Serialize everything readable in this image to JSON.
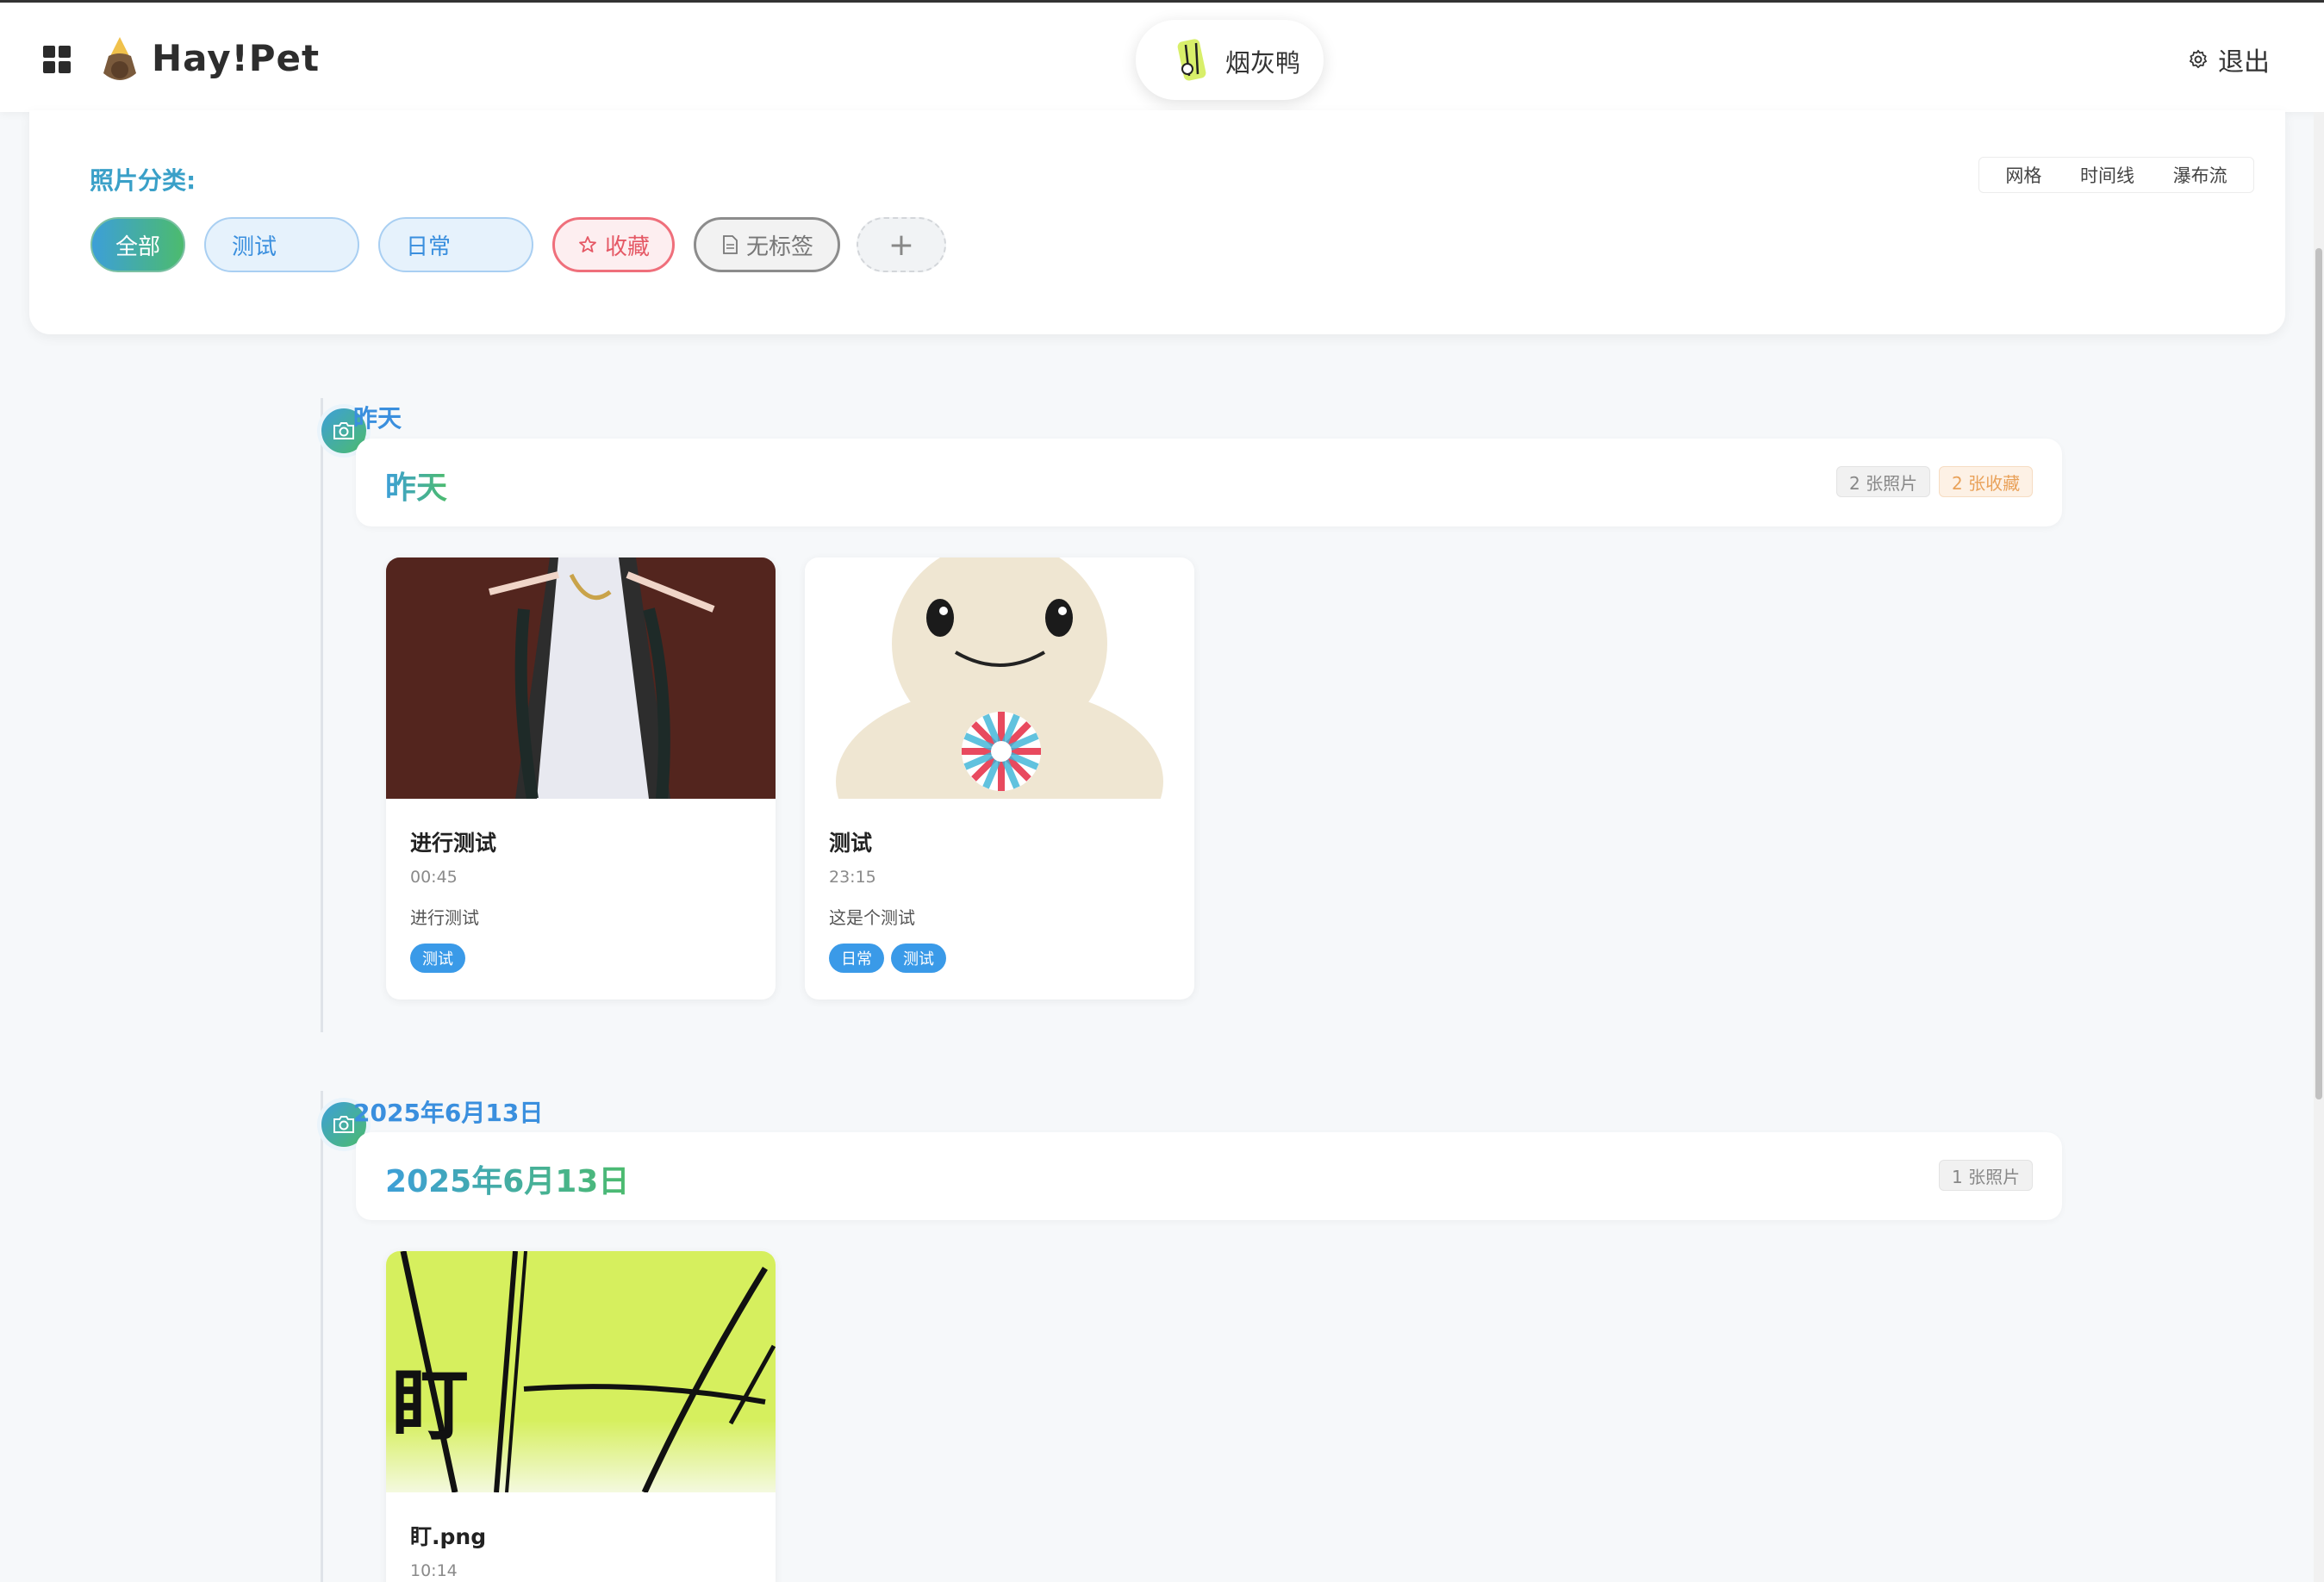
{
  "header": {
    "app_name": "Hay!Pet",
    "user_name": "烟灰鸭",
    "logout_label": "退出"
  },
  "filter": {
    "title": "照片分类:",
    "views": [
      "网格",
      "时间线",
      "瀑布流"
    ],
    "chips": {
      "all": "全部",
      "test": "测试",
      "daily": "日常",
      "favorite": "收藏",
      "no_tag": "无标签",
      "add": "+"
    }
  },
  "groups": [
    {
      "label": "昨天",
      "title": "昨天",
      "photo_count": "2 张照片",
      "fav_count": "2 张收藏",
      "photos": [
        {
          "title": "进行测试",
          "time": "00:45",
          "desc": "进行测试",
          "tags": [
            "测试"
          ]
        },
        {
          "title": "测试",
          "time": "23:15",
          "desc": "这是个测试",
          "tags": [
            "日常",
            "测试"
          ]
        }
      ]
    },
    {
      "label": "2025年6月13日",
      "title": "2025年6月13日",
      "photo_count": "1 张照片",
      "photos": [
        {
          "title": "盯.png",
          "time": "10:14"
        }
      ]
    }
  ],
  "colors": {
    "accent_blue": "#3a8fde",
    "accent_green": "#4cbb6e",
    "favorite_red": "#e55865",
    "tag_blue": "#3a9ae8"
  }
}
